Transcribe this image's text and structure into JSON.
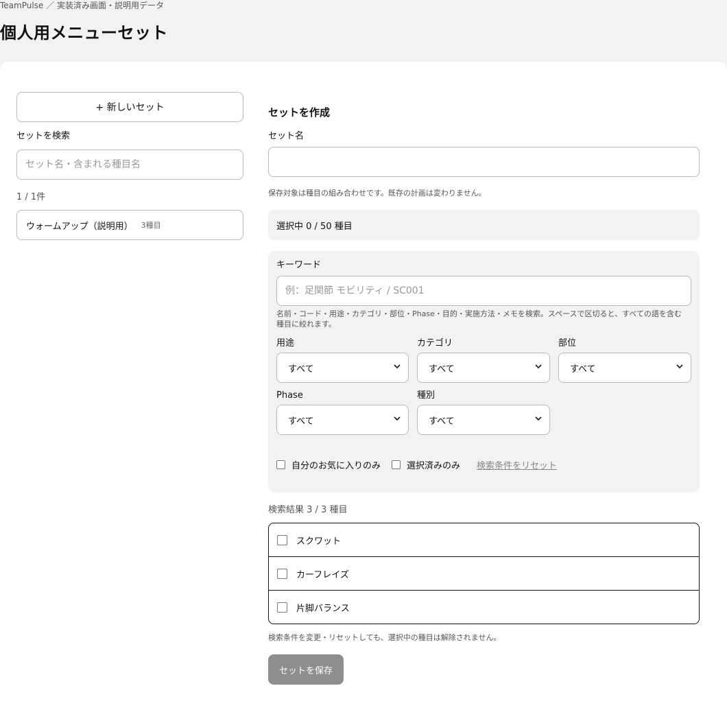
{
  "breadcrumb": "TeamPulse ／ 実装済み画面・説明用データ",
  "page_title": "個人用メニューセット",
  "left": {
    "new_set_button": "+ 新しいセット",
    "search_label": "セットを検索",
    "search_placeholder": "セット名・含まれる種目名",
    "count": "1 / 1件",
    "sets": [
      {
        "name": "ウォームアップ（説明用）",
        "sub": "3種目"
      }
    ]
  },
  "right": {
    "section_title": "セットを作成",
    "set_name_label": "セット名",
    "set_name_value": "",
    "save_note": "保存対象は種目の組み合わせです。既存の計画は変わりません。",
    "selected_text": "選択中 0 / 50 種目",
    "filters": {
      "keyword_label": "キーワード",
      "keyword_placeholder": "例：足関節 モビリティ / SC001",
      "keyword_help": "名前・コード・用途・カテゴリ・部位・Phase・目的・実施方法・メモを検索。スペースで区切ると、すべての語を含む種目に絞れます。",
      "selects": [
        {
          "label": "用途",
          "value": "すべて"
        },
        {
          "label": "カテゴリ",
          "value": "すべて"
        },
        {
          "label": "部位",
          "value": "すべて"
        },
        {
          "label": "Phase",
          "value": "すべて"
        },
        {
          "label": "種別",
          "value": "すべて"
        }
      ],
      "favorites_only": "自分のお気に入りのみ",
      "selected_only": "選択済みのみ",
      "reset_link": "検索条件をリセット"
    },
    "results_label": "検索結果 3 / 3 種目",
    "results": [
      "スクワット",
      "カーフレイズ",
      "片脚バランス"
    ],
    "selection_note": "検索条件を変更・リセットしても、選択中の種目は解除されません。",
    "save_button": "セットを保存"
  }
}
